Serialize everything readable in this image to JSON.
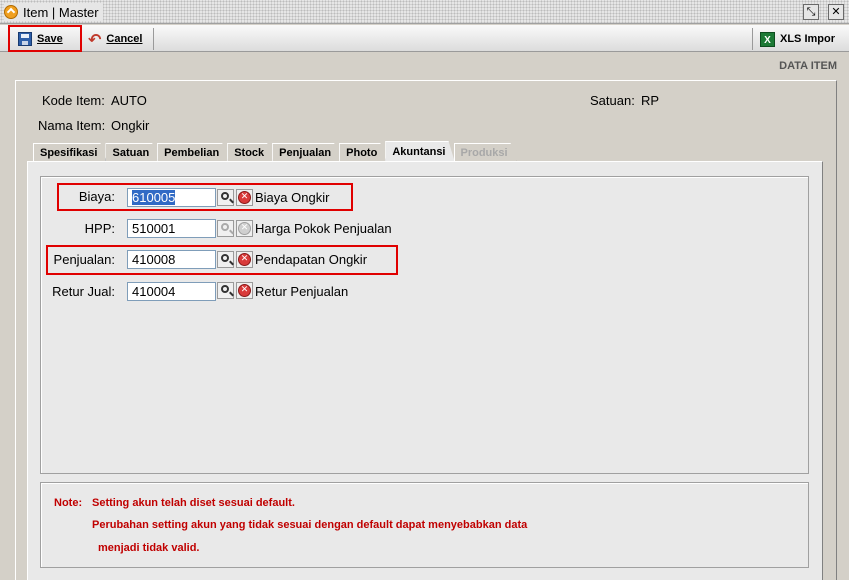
{
  "window": {
    "title": "Item | Master",
    "icons": {
      "app": "app-logo-icon",
      "restore": "restore-icon",
      "close": "close-icon"
    }
  },
  "toolbar": {
    "save_label": "Save",
    "cancel_label": "Cancel",
    "import_label": "XLS Impor",
    "icons": {
      "save": "floppy-disk-icon",
      "cancel": "undo-arrow-icon",
      "import": "excel-icon"
    }
  },
  "header": {
    "section_title": "DATA ITEM"
  },
  "item": {
    "kode_label": "Kode Item:",
    "kode_value": "AUTO",
    "nama_label": "Nama Item:",
    "nama_value": "Ongkir",
    "satuan_label": "Satuan:",
    "satuan_value": "RP"
  },
  "tabs": [
    {
      "label": "Spesifikasi",
      "state": "normal"
    },
    {
      "label": "Satuan",
      "state": "normal"
    },
    {
      "label": "Pembelian",
      "state": "normal"
    },
    {
      "label": "Stock",
      "state": "normal"
    },
    {
      "label": "Penjualan",
      "state": "normal"
    },
    {
      "label": "Photo",
      "state": "normal"
    },
    {
      "label": "Akuntansi",
      "state": "active"
    },
    {
      "label": "Produksi",
      "state": "disabled"
    }
  ],
  "accounts": [
    {
      "label": "Biaya:",
      "code": "610005",
      "name": "Biaya Ongkir",
      "enabled": true,
      "selected": true
    },
    {
      "label": "HPP:",
      "code": "510001",
      "name": "Harga Pokok Penjualan",
      "enabled": false,
      "selected": false
    },
    {
      "label": "Penjualan:",
      "code": "410008",
      "name": "Pendapatan Ongkir",
      "enabled": true,
      "selected": false
    },
    {
      "label": "Retur Jual:",
      "code": "410004",
      "name": "Retur Penjualan",
      "enabled": true,
      "selected": false
    }
  ],
  "note": {
    "prefix": "Note:",
    "line1": "Setting akun telah diset sesuai default.",
    "line2": "Perubahan setting akun yang tidak sesuai dengan default dapat menyebabkan data",
    "line3": "menjadi tidak valid."
  },
  "colors": {
    "highlight_box": "#e00000",
    "note_text": "#c00000",
    "selection": "#316ac5"
  }
}
